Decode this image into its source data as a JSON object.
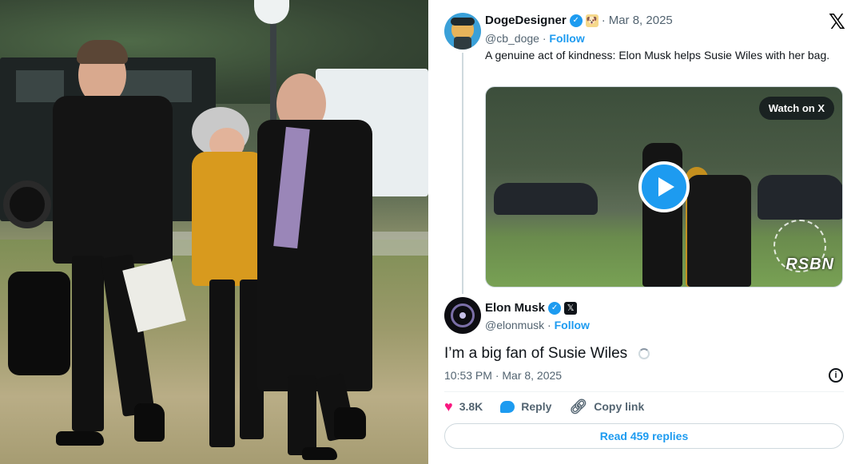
{
  "tweet": {
    "author": {
      "name": "DogeDesigner",
      "handle": "@cb_doge",
      "follow_label": "Follow",
      "date": "Mar 8, 2025",
      "text": "A genuine act of kindness: Elon Musk helps Susie Wiles with her bag."
    },
    "video": {
      "watch_label": "Watch on X",
      "watermark": "RSBN"
    },
    "reply": {
      "name": "Elon Musk",
      "handle": "@elonmusk",
      "follow_label": "Follow",
      "text": "I’m a big fan of Susie Wiles",
      "timestamp": "10:53 PM · Mar 8, 2025"
    },
    "actions": {
      "likes": "3.8K",
      "reply_label": "Reply",
      "copy_label": "Copy link",
      "read_replies_label": "Read 459 replies"
    }
  },
  "colors": {
    "accent": "#1d9bf0",
    "like": "#f91880",
    "muted": "#536471"
  },
  "icons": [
    "verified-badge-icon",
    "x-logo-icon",
    "play-icon",
    "heart-icon",
    "reply-bubble-icon",
    "link-icon",
    "info-icon"
  ]
}
